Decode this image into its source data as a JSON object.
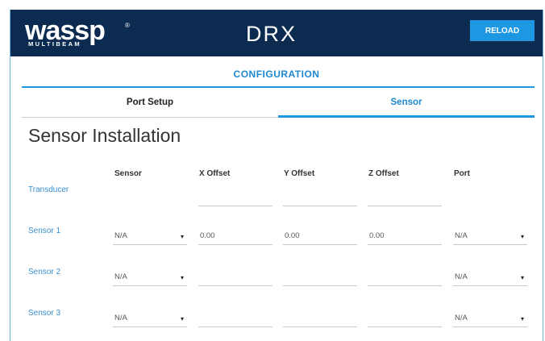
{
  "header": {
    "logo_text": "wassp",
    "logo_tm": "®",
    "logo_sub": "MULTIBEAM",
    "app_title": "DRX",
    "reload_label": "RELOAD",
    "bg_color": "#0c2b50",
    "accent_color": "#1e97e3"
  },
  "section": {
    "title": "CONFIGURATION"
  },
  "tabs": [
    {
      "label": "Port Setup",
      "active": false
    },
    {
      "label": "Sensor",
      "active": true
    }
  ],
  "page": {
    "heading": "Sensor Installation"
  },
  "table": {
    "columns": [
      "Sensor",
      "X Offset",
      "Y Offset",
      "Z Offset",
      "Port"
    ],
    "rows": [
      {
        "label": "Transducer",
        "sensor": "",
        "x": "",
        "y": "",
        "z": "",
        "port": ""
      },
      {
        "label": "Sensor 1",
        "sensor": "N/A",
        "x": "0.00",
        "y": "0.00",
        "z": "0.00",
        "port": "N/A"
      },
      {
        "label": "Sensor 2",
        "sensor": "N/A",
        "x": "",
        "y": "",
        "z": "",
        "port": "N/A"
      },
      {
        "label": "Sensor 3",
        "sensor": "N/A",
        "x": "",
        "y": "",
        "z": "",
        "port": "N/A"
      }
    ],
    "caret_icon": "▾"
  }
}
